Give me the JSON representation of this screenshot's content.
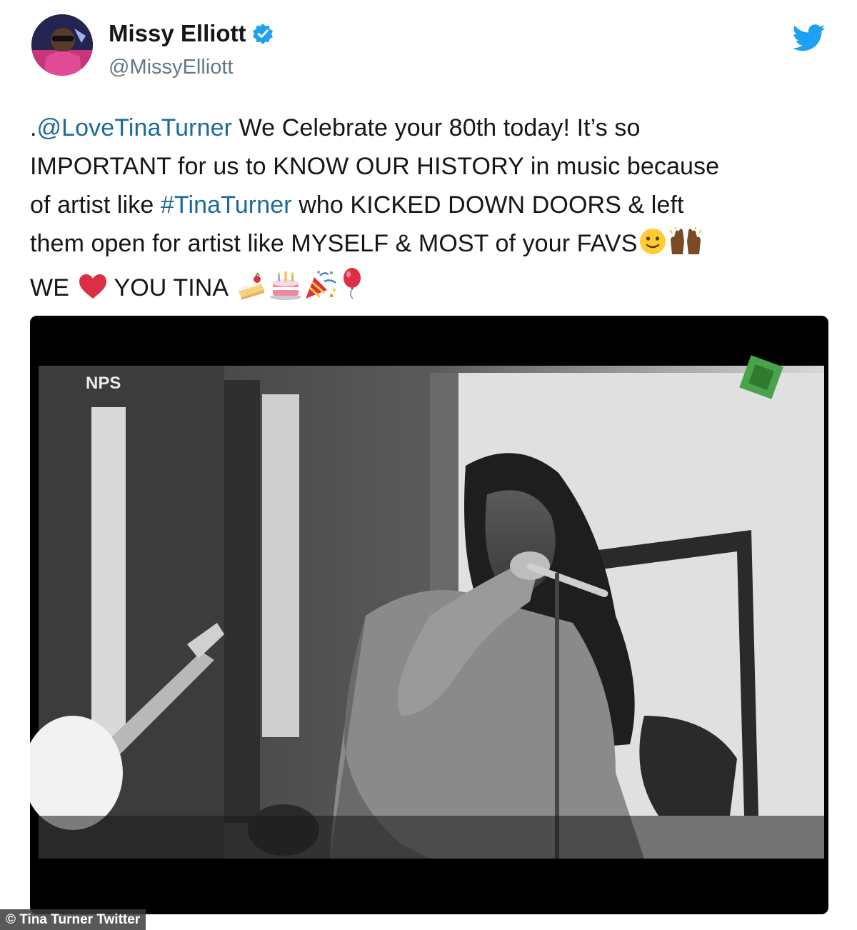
{
  "author": {
    "display_name": "Missy Elliott",
    "handle": "@MissyElliott",
    "verified": true,
    "avatar_icon": "avatar-photo"
  },
  "platform_icon": "twitter-bird-icon",
  "tweet": {
    "line1_prefix": ".",
    "line1_mention": "@LoveTinaTurner",
    "line1_rest": " We Celebrate your 80th today! It’s so",
    "line2": "IMPORTANT for us to KNOW OUR HISTORY in music because",
    "line3_prefix": "of artist like ",
    "line3_hashtag": "#TinaTurner",
    "line3_rest": " who KICKED DOWN DOORS & left",
    "line4": "them open for artist like MYSELF & MOST of your FAVS",
    "line5_we": "WE",
    "line5_you": " YOU TINA ",
    "emojis_line4": [
      "slightly-smiling-face",
      "raising-hands"
    ],
    "emojis_line5": [
      "red-heart",
      "shortcake",
      "birthday-cake",
      "party-popper",
      "balloon"
    ]
  },
  "media": {
    "type": "video-still",
    "watermark_left": "NPS"
  },
  "credit": "© Tina Turner Twitter",
  "colors": {
    "link": "#1b6a9a",
    "twitter_blue": "#1da1f2",
    "text": "#14171a",
    "muted": "#657786"
  }
}
